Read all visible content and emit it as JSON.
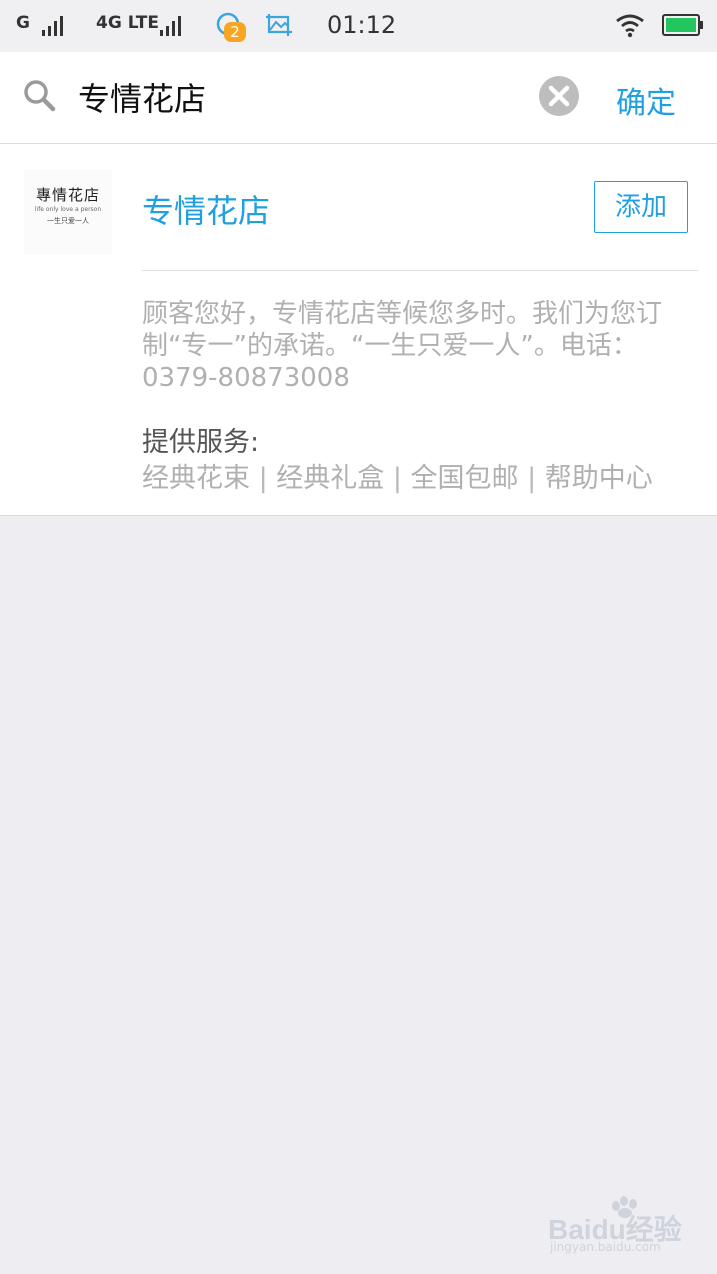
{
  "status_bar": {
    "carrier1": "G",
    "carrier2": "4G LTE",
    "notification_count": "2",
    "time": "01:12"
  },
  "search": {
    "query": "专情花店",
    "confirm_label": "确定"
  },
  "result": {
    "logo": {
      "title": "專情花店",
      "tagline": "life only love a person",
      "subline": "一生只爱一人"
    },
    "name": "专情花店",
    "add_label": "添加",
    "description": "顾客您好，专情花店等候您多时。我们为您订制“专一”的承诺。“一生只爱一人”。电话：0379-80873008",
    "services_label": "提供服务:",
    "services": [
      "经典花束",
      "经典礼盒",
      "全国包邮",
      "帮助中心"
    ],
    "separator": " | "
  },
  "watermark": {
    "main": "Baidu经验",
    "sub": "jingyan.baidu.com"
  },
  "colors": {
    "accent": "#20a0e0",
    "muted_text": "#b0b0b0",
    "background": "#eeeef2",
    "battery": "#22c55e",
    "badge": "#f6a623"
  }
}
